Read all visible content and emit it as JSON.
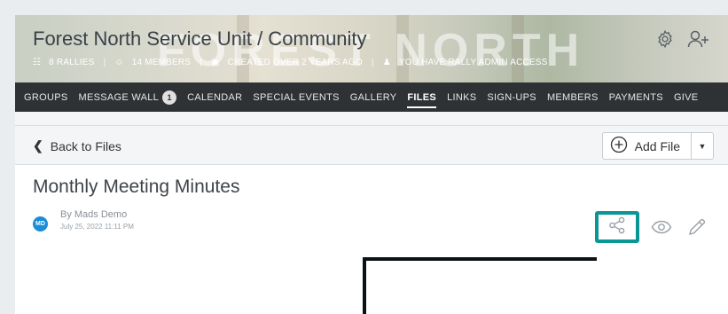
{
  "colors": {
    "accent": "#0a9597",
    "nav_bg": "#2f3234",
    "avatar_bg": "#1a8cd8"
  },
  "hero": {
    "title": "Forest North Service Unit / Community",
    "watermark": "FOREST NORTH",
    "meta": {
      "rallies": "8 RALLIES",
      "members": "14 MEMBERS",
      "created": "CREATED OVER 2 YEARS AGO",
      "access": "YOU HAVE RALLY ADMIN ACCESS"
    },
    "icons": [
      "gear-icon",
      "add-user-icon"
    ]
  },
  "nav": {
    "items": [
      {
        "label": "GROUPS"
      },
      {
        "label": "MESSAGE WALL",
        "badge": "1"
      },
      {
        "label": "CALENDAR"
      },
      {
        "label": "SPECIAL EVENTS"
      },
      {
        "label": "GALLERY"
      },
      {
        "label": "FILES",
        "active": true
      },
      {
        "label": "LINKS"
      },
      {
        "label": "SIGN-UPS"
      },
      {
        "label": "MEMBERS"
      },
      {
        "label": "PAYMENTS"
      },
      {
        "label": "GIVE"
      }
    ]
  },
  "toolbar": {
    "back_label": "Back to Files",
    "add_file_label": "Add File"
  },
  "document": {
    "title": "Monthly Meeting Minutes",
    "author": {
      "initials": "MD",
      "byline": "By Mads Demo",
      "date": "July 25, 2022 11:11 PM"
    },
    "actions": [
      "share-icon",
      "eye-icon",
      "pencil-icon"
    ]
  }
}
